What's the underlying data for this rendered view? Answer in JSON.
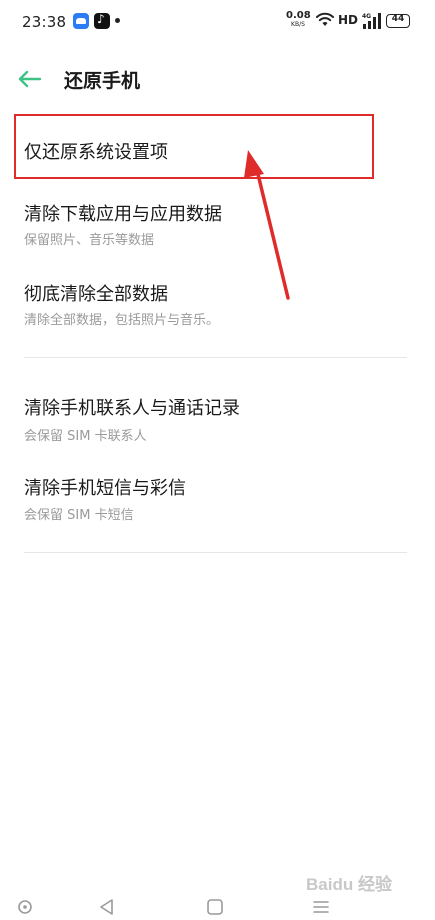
{
  "status_bar": {
    "time": "23:38",
    "net_speed_value": "0.08",
    "net_speed_unit": "KB/S",
    "network_label": "HD",
    "signal_label": "4G",
    "battery_level": "44",
    "notification_icons": [
      "cloud-app-icon",
      "tiktok-icon"
    ]
  },
  "header": {
    "title": "还原手机",
    "back_icon": "back-arrow-icon",
    "accent_color": "#3cc386"
  },
  "sections": [
    {
      "items": [
        {
          "title": "仅还原系统设置项",
          "subtitle": ""
        },
        {
          "title": "清除下载应用与应用数据",
          "subtitle": "保留照片、音乐等数据"
        },
        {
          "title": "彻底清除全部数据",
          "subtitle": "清除全部数据，包括照片与音乐。"
        }
      ]
    },
    {
      "items": [
        {
          "title": "清除手机联系人与通话记录",
          "subtitle": "会保留 SIM 卡联系人"
        },
        {
          "title": "清除手机短信与彩信",
          "subtitle": "会保留 SIM 卡短信"
        }
      ]
    }
  ],
  "annotation": {
    "color": "#e02b2b",
    "target": "仅还原系统设置项"
  },
  "nav_bar": {
    "buttons": [
      "home-dot-icon",
      "back-triangle-icon",
      "recents-square-icon",
      "menu-icon"
    ]
  },
  "watermark": "Baidu 经验"
}
